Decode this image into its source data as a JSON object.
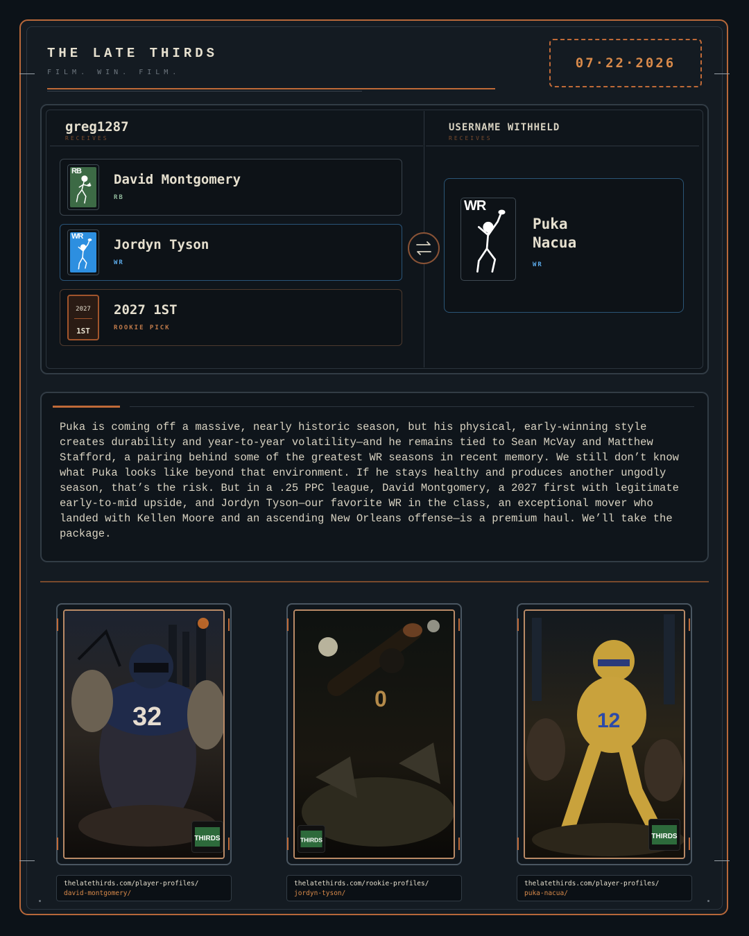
{
  "brand": {
    "title": "THE LATE THIRDS",
    "tagline": "FILM. WIN. FILM."
  },
  "date": "07·22·2026",
  "trade": {
    "left": {
      "username": "greg1287",
      "receives_label": "RECEIVES",
      "assets": [
        {
          "name": "David Montgomery",
          "position": "RB",
          "tile_label": "RB",
          "color": "#3c6a45"
        },
        {
          "name": "Jordyn Tyson",
          "position": "WR",
          "tile_label": "WR",
          "color": "#2d8fe0"
        },
        {
          "name": "2027 1ST",
          "position": "ROOKIE PICK",
          "pick_year": "2027",
          "pick_round": "1ST"
        }
      ]
    },
    "right": {
      "username": "USERNAME WITHHELD",
      "receives_label": "RECEIVES",
      "assets": [
        {
          "name_line1": "Puka",
          "name_line2": "Nacua",
          "position": "WR",
          "tile_label": "WR",
          "color": "#2d8fe0"
        }
      ]
    },
    "swap_icon": "swap-arrows-icon"
  },
  "analysis": {
    "text": "Puka is coming off a massive, nearly historic season, but his physical, early-winning style creates durability and year-to-year volatility—and he remains tied to Sean McVay and Matthew Stafford, a pairing behind some of the greatest WR seasons in recent memory. We still don’t know what Puka looks like beyond that environment. If he stays healthy and produces another ungodly season, that’s the risk. But in a .25 PPC league, David Montgomery, a 2027 first with legitimate early-to-mid upside, and Jordyn Tyson—our favorite WR in the class, an exceptional mover who landed with Kellen Moore and an ascending New Orleans offense—is a premium haul. We’ll take the package."
  },
  "cards": [
    {
      "url_line1": "thelatethirds.com/player-profiles/",
      "url_line2": "david-montgomery/",
      "jersey": "32"
    },
    {
      "url_line1": "thelatethirds.com/rookie-profiles/",
      "url_line2": "jordyn-tyson/",
      "jersey": "0"
    },
    {
      "url_line1": "thelatethirds.com/player-profiles/",
      "url_line2": "puka-nacua/",
      "jersey": "12"
    }
  ],
  "colors": {
    "accent": "#c06a38",
    "rb": "#3c6a45",
    "wr": "#2d8fe0",
    "background": "#0c1218"
  }
}
